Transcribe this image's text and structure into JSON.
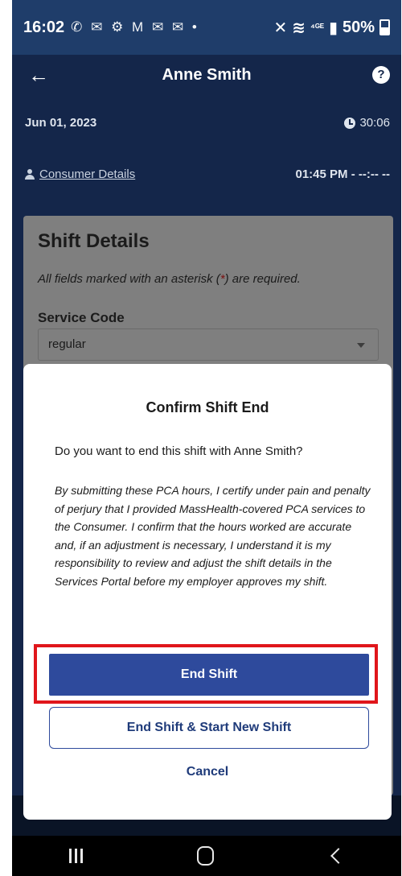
{
  "status_bar": {
    "time": "16:02",
    "notification_icons": "✆ ✉ ⚙ M ✉ ✉ •",
    "network": "⁴ᴳᴱ",
    "battery": "50%"
  },
  "header": {
    "title": "Anne Smith",
    "date": "Jun 01, 2023",
    "timer": "30:06",
    "consumer_link": "Consumer Details",
    "time_range": "01:45 PM - --:-- --"
  },
  "card": {
    "title": "Shift Details",
    "required_note_prefix": "All fields marked with an asterisk (",
    "required_note_asterisk": "*",
    "required_note_suffix": ") are required.",
    "service_code_label": "Service Code",
    "service_code_value": "regular"
  },
  "modal": {
    "title": "Confirm Shift End",
    "question": "Do you want to end this shift with  Anne Smith?",
    "legal_text": "By submitting these PCA hours, I certify under pain and penalty of perjury that I provided MassHealth-covered PCA services to the Consumer.  I confirm that the hours worked are accurate and, if an adjustment is necessary, I understand it is my responsibility to review and adjust the shift details in the Services Portal before my employer approves my shift.",
    "end_shift_label": "End Shift",
    "end_and_start_label": "End Shift & Start New Shift",
    "cancel_label": "Cancel"
  },
  "colors": {
    "header_bg": "#14264a",
    "primary_button": "#2e4a9c",
    "highlight_border": "#e0161b"
  }
}
